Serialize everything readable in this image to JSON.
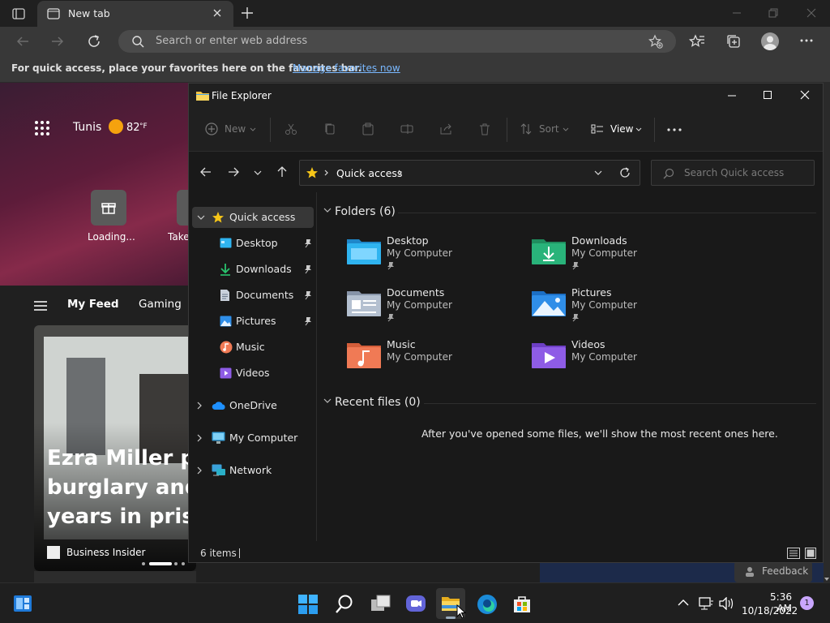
{
  "browser": {
    "tab_title": "New tab",
    "address_placeholder": "Search or enter web address",
    "favbar_text": "For quick access, place your favorites here on the favorites bar.",
    "favbar_link": "Manage favorites now"
  },
  "ntp": {
    "city": "Tunis",
    "temp": "82",
    "temp_unit": "°F",
    "tiles": [
      "Loading...",
      "Take"
    ],
    "feed_tabs": [
      "My Feed",
      "Gaming"
    ],
    "headline": "Ezra Miller ple\nburglary and\nyears in prison",
    "source": "Business Insider",
    "feedback": "Feedback"
  },
  "explorer": {
    "title": "File Explorer",
    "toolbar": {
      "new": "New",
      "sort": "Sort",
      "view": "View"
    },
    "breadcrumb": "Quick access",
    "search_placeholder": "Search Quick access",
    "sidebar": [
      {
        "label": "Quick access",
        "icon": "star-icon",
        "pinned": false
      },
      {
        "label": "Desktop",
        "icon": "desktop-icon",
        "pinned": true
      },
      {
        "label": "Downloads",
        "icon": "download-icon",
        "pinned": true
      },
      {
        "label": "Documents",
        "icon": "document-icon",
        "pinned": true
      },
      {
        "label": "Pictures",
        "icon": "pictures-icon",
        "pinned": true
      },
      {
        "label": "Music",
        "icon": "music-icon",
        "pinned": false
      },
      {
        "label": "Videos",
        "icon": "videos-icon",
        "pinned": false
      },
      {
        "label": "OneDrive",
        "icon": "cloud-icon",
        "pinned": false
      },
      {
        "label": "My Computer",
        "icon": "computer-icon",
        "pinned": false
      },
      {
        "label": "Network",
        "icon": "network-icon",
        "pinned": false
      }
    ],
    "folders_header": "Folders (6)",
    "folders": [
      {
        "name": "Desktop",
        "location": "My Computer",
        "pinned": true,
        "color": "#2fb4f0"
      },
      {
        "name": "Downloads",
        "location": "My Computer",
        "pinned": true,
        "color": "#29b37a"
      },
      {
        "name": "Documents",
        "location": "My Computer",
        "pinned": true,
        "color": "#a9b6c8"
      },
      {
        "name": "Pictures",
        "location": "My Computer",
        "pinned": true,
        "color": "#2f8ee8"
      },
      {
        "name": "Music",
        "location": "My Computer",
        "pinned": false,
        "color": "#f07a55"
      },
      {
        "name": "Videos",
        "location": "My Computer",
        "pinned": false,
        "color": "#8e5ce6"
      }
    ],
    "recent_header": "Recent files (0)",
    "recent_empty": "After you've opened some files, we'll show the most recent ones here.",
    "status": "6 items"
  },
  "taskbar": {
    "time": "5:36 AM",
    "date": "10/18/2022",
    "notification_count": "1"
  }
}
